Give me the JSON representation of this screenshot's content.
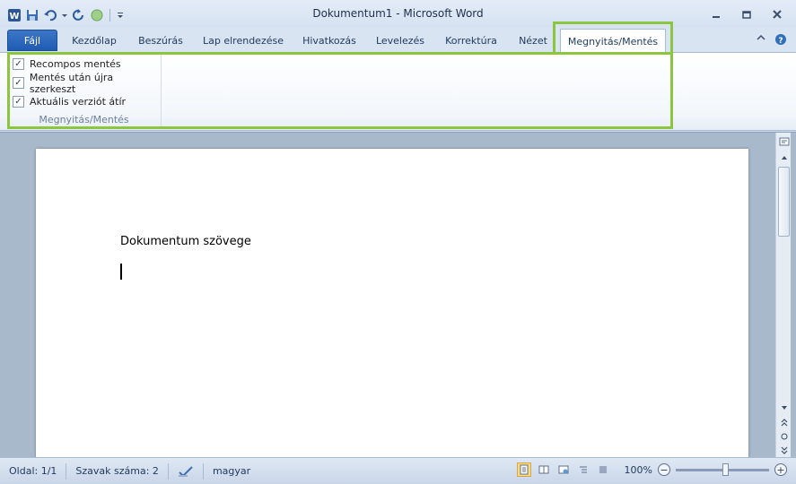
{
  "window": {
    "title": "Dokumentum1 - Microsoft Word"
  },
  "quick_access": {
    "icons": [
      "word-app-icon",
      "save-icon",
      "undo-icon",
      "undo-dropdown-icon",
      "redo-icon",
      "circle-icon",
      "customize-dropdown-icon"
    ]
  },
  "tabs": {
    "file": "Fájl",
    "items": [
      "Kezdőlap",
      "Beszúrás",
      "Lap elrendezése",
      "Hivatkozás",
      "Levelezés",
      "Korrektúra",
      "Nézet"
    ],
    "active": "Megnyitás/Mentés"
  },
  "ribbon": {
    "group_label": "Megnyitás/Mentés",
    "checkboxes": [
      {
        "label": "Recompos mentés",
        "checked": true
      },
      {
        "label": "Mentés után újra szerkeszt",
        "checked": true
      },
      {
        "label": "Aktuális verziót átír",
        "checked": true
      }
    ]
  },
  "document": {
    "text": "Dokumentum szövege"
  },
  "status": {
    "page": "Oldal: 1/1",
    "words": "Szavak száma: 2",
    "language": "magyar",
    "zoom": "100%",
    "zoom_level": 1.0
  },
  "colors": {
    "highlight": "#8cc63f",
    "file_tab": "#2a64b8"
  }
}
